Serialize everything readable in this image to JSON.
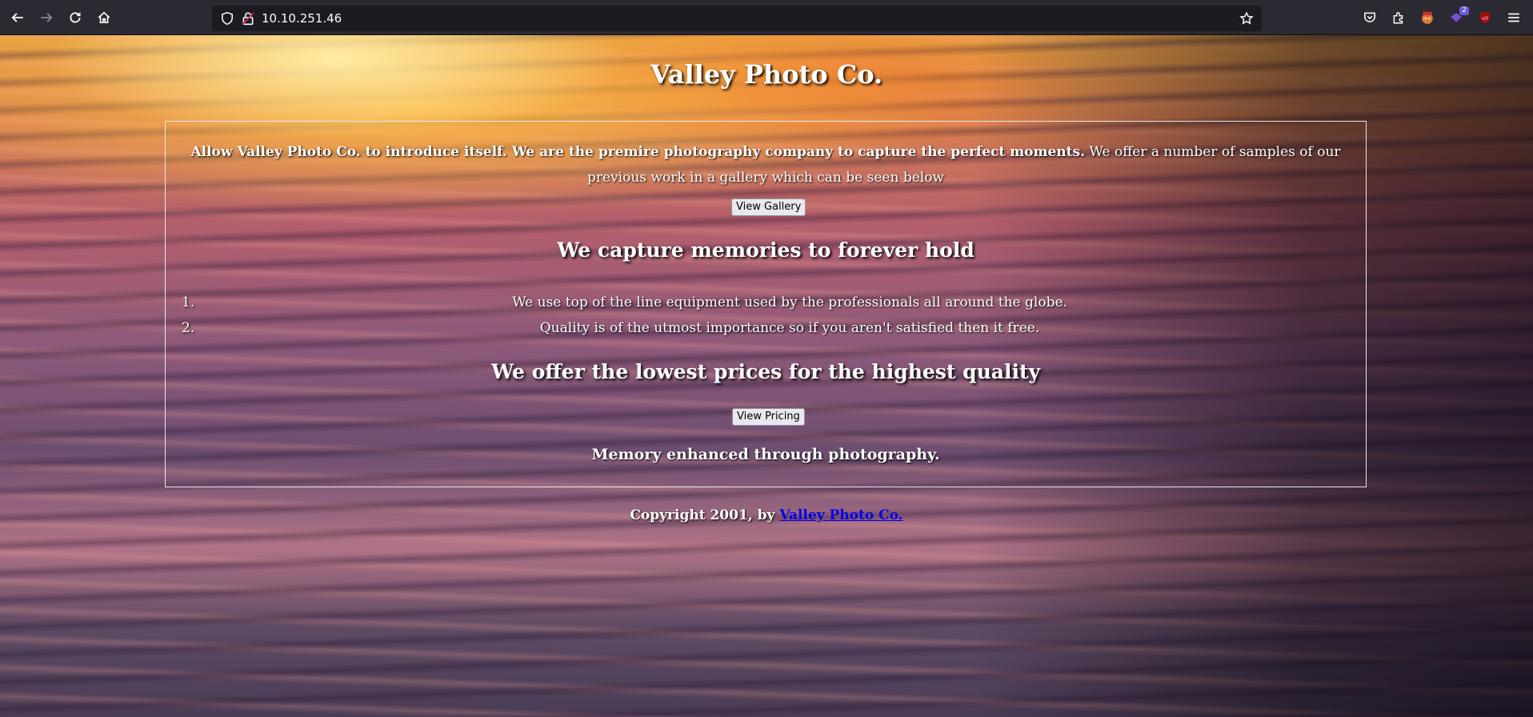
{
  "browser": {
    "url": "10.10.251.46",
    "extension_badge": "2",
    "icons": [
      "back-icon",
      "forward-icon",
      "reload-icon",
      "home-icon",
      "shield-icon",
      "lock-icon",
      "bookmark-star-icon",
      "pocket-icon",
      "extensions-icon",
      "foxyproxy-icon",
      "extension-badge-icon",
      "ublock-icon",
      "menu-icon"
    ]
  },
  "page": {
    "title": "Valley Photo Co.",
    "intro_bold": "Allow Valley Photo Co. to introduce itself. We are the premire photography company to capture the perfect moments.",
    "intro_rest": " We offer a number of samples of our previous work in a gallery which can be seen below",
    "gallery_button": "View Gallery",
    "heading_memories": "We capture memories to forever hold",
    "list": [
      {
        "num": "1.",
        "text": "We use top of the line equipment used by the professionals all around the globe."
      },
      {
        "num": "2.",
        "text": "Quality is of the utmost importance so if you aren't satisfied then it free."
      }
    ],
    "heading_prices": "We offer the lowest prices for the highest quality",
    "pricing_button": "View Pricing",
    "tagline": "Memory enhanced through photography.",
    "footer_prefix": "Copyright 2001, by ",
    "footer_link": "Valley Photo Co."
  },
  "colors": {
    "chrome_bg": "#2b2a33",
    "link": "#0000ee",
    "text": "#ffffff"
  }
}
